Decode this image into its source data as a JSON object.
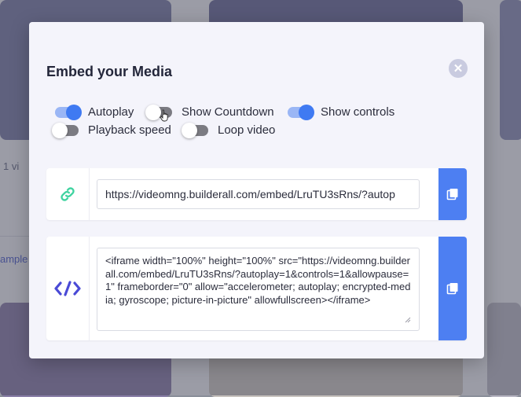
{
  "background": {
    "snippet_1": "1 vi",
    "snippet_2": "ample"
  },
  "modal": {
    "title": "Embed your Media",
    "close_icon": "close-icon"
  },
  "toggles": [
    {
      "label": "Autoplay",
      "on": true
    },
    {
      "label": "Show Countdown",
      "on": false
    },
    {
      "label": "Show controls",
      "on": true
    },
    {
      "label": "Playback speed",
      "on": false
    },
    {
      "label": "Loop video",
      "on": false
    }
  ],
  "embed": {
    "url_value": "https://videomng.builderall.com/embed/LruTU3sRns/?autop",
    "url_icon": "link-icon",
    "code_icon": "code-icon",
    "code_value": "<iframe width=\"100%\" height=\"100%\" src=\"https://videomng.builderall.com/embed/LruTU3sRns/?autoplay=1&controls=1&allowpause=1\" frameborder=\"0\" allow=\"accelerometer; autoplay; encrypted-media; gyroscope; picture-in-picture\" allowfullscreen></iframe>",
    "copy_icon": "copy-icon"
  },
  "colors": {
    "accent": "#4d7ff2",
    "toggle_on": "#3f7af2",
    "link_icon": "#3fd3a0",
    "code_icon": "#4a4ad6"
  }
}
